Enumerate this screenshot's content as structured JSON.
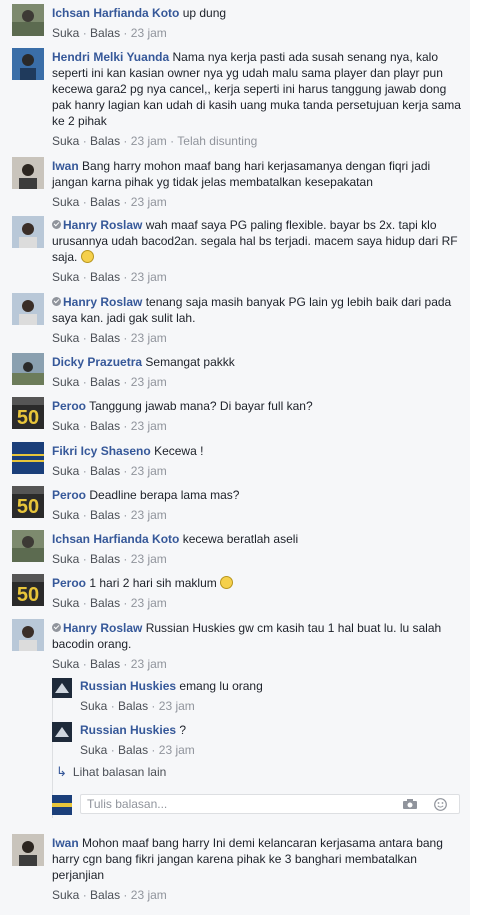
{
  "common": {
    "like": "Suka",
    "reply": "Balas",
    "dot": "·",
    "time": "23 jam"
  },
  "comments": [
    {
      "name": "Ichsan Harfianda Koto",
      "text": "up dung"
    },
    {
      "name": "Hendri Melki Yuanda",
      "text": "Nama nya kerja pasti ada susah senang nya, kalo seperti ini kan kasian owner nya yg udah malu sama player dan playr pun kecewa gara2 pg nya cancel,, kerja seperti ini harus tanggung jawab dong pak hanry lagian kan udah di kasih uang muka tanda persetujuan kerja sama ke 2 pihak",
      "edited": "Telah disunting"
    },
    {
      "name": "Iwan",
      "text": "Bang harry mohon maaf bang hari kerjasamanya dengan fiqri jadi jangan karna pihak yg tidak jelas membatalkan kesepakatan"
    },
    {
      "name": "Hanry Roslaw",
      "text": "wah maaf saya PG paling flexible. bayar bs 2x. tapi klo urusannya udah bacod2an. segala hal bs terjadi. macem saya hidup dari RF saja."
    },
    {
      "name": "Hanry Roslaw",
      "text": "tenang saja masih banyak PG lain yg lebih baik dari pada saya kan. jadi gak sulit lah."
    },
    {
      "name": "Dicky Prazuetra",
      "text": "Semangat pakkk"
    },
    {
      "name": "Peroo",
      "text": "Tanggung jawab mana? Di bayar full kan?"
    },
    {
      "name": "Fikri Icy Shaseno",
      "text": "Kecewa !"
    },
    {
      "name": "Peroo",
      "text": "Deadline berapa lama mas?"
    },
    {
      "name": "Ichsan Harfianda Koto",
      "text": "kecewa beratlah aseli"
    },
    {
      "name": "Peroo",
      "text": "1 hari 2 hari sih maklum"
    },
    {
      "name": "Hanry Roslaw",
      "text": "Russian Huskies gw cm kasih tau 1 hal buat lu. lu salah bacodin orang."
    },
    {
      "name": "Russian Huskies",
      "text": "emang lu orang"
    },
    {
      "name": "Russian Huskies",
      "text": "?"
    },
    {
      "name": "Iwan",
      "text": "Mohon maaf bang harry Ini demi kelancaran kerjasama antara bang harry cgn bang fikri jangan karena pihak ke 3 banghari membatalkan perjanjian"
    }
  ],
  "more_replies": "Lihat balasan lain",
  "reply_input": {
    "placeholder": "Tulis balasan..."
  }
}
